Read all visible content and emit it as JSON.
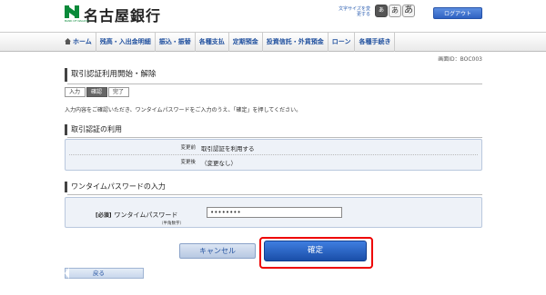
{
  "header": {
    "bank_name": "名古屋銀行",
    "logo_sub": "BANK OF NAGOYA",
    "font_size_label": "文字サイズを変更する",
    "font_sizes": [
      "あ",
      "あ",
      "あ"
    ],
    "logout_label": "ログアウト"
  },
  "nav": {
    "items": [
      {
        "label": "ホーム",
        "icon": "home-icon"
      },
      {
        "label": "残高・入出金明細"
      },
      {
        "label": "振込・振替"
      },
      {
        "label": "各種支払"
      },
      {
        "label": "定期預金"
      },
      {
        "label": "投資信託・外貨預金"
      },
      {
        "label": "ローン"
      },
      {
        "label": "各種手続き"
      }
    ]
  },
  "screen_id": "画面ID：BOC003",
  "page": {
    "title": "取引認証利用開始・解除",
    "steps": [
      "入力",
      "確認",
      "完了"
    ],
    "active_step": 1,
    "intro": "入力内容をご確認いただき、ワンタイムパスワードをご入力のうえ、「確定」を押してください。"
  },
  "usage": {
    "title": "取引認証の利用",
    "before_label": "変更前",
    "before_value": "取引認証を利用する",
    "after_label": "変更後",
    "after_value": "（変更なし）"
  },
  "otp": {
    "title": "ワンタイムパスワードの入力",
    "required": "[必須]",
    "label": "ワンタイムパスワード",
    "sub_label": "（半角数字）",
    "value": "••••••••"
  },
  "buttons": {
    "cancel": "キャンセル",
    "confirm": "確定",
    "back": "戻る"
  },
  "colors": {
    "brand_green": "#0a8a3a",
    "accent_blue": "#2f62c2",
    "highlight_red": "#ee0000"
  }
}
